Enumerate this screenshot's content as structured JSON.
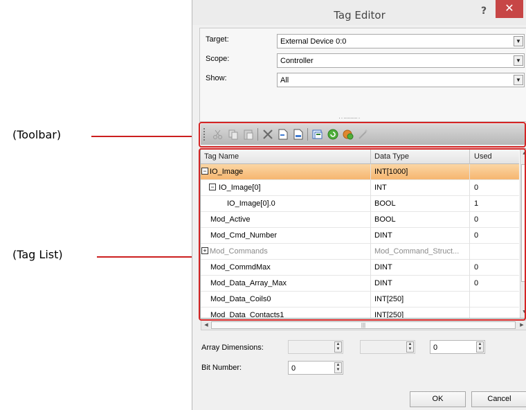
{
  "annotations": {
    "toolbar_label": "(Toolbar)",
    "taglist_label": "(Tag List)",
    "accent": "#d42424"
  },
  "dialog": {
    "title": "Tag Editor",
    "help_glyph": "?",
    "close_glyph": "✕"
  },
  "filters": {
    "target_label": "Target:",
    "target_value": "External Device 0:0",
    "scope_label": "Scope:",
    "scope_value": "Controller",
    "show_label": "Show:",
    "show_value": "All",
    "splitter": "· · ·········· ·"
  },
  "toolbar": {
    "icons": [
      "cut-icon",
      "copy-icon",
      "paste-icon",
      "delete-icon",
      "new-tag-icon",
      "new-structure-icon",
      "import-icon",
      "refresh-icon",
      "monitor-icon",
      "wand-icon"
    ]
  },
  "grid": {
    "columns": [
      "Tag Name",
      "Data Type",
      "Used"
    ],
    "rows": [
      {
        "name": "IO_Image",
        "type": "INT[1000]",
        "used": "",
        "expander": "−",
        "indent": 0,
        "selected": true,
        "grey": false
      },
      {
        "name": "IO_Image[0]",
        "type": "INT",
        "used": "0",
        "expander": "−",
        "indent": 1,
        "selected": false,
        "grey": false
      },
      {
        "name": "IO_Image[0].0",
        "type": "BOOL",
        "used": "1",
        "expander": "",
        "indent": 2,
        "selected": false,
        "grey": false
      },
      {
        "name": "Mod_Active",
        "type": "BOOL",
        "used": "0",
        "expander": "",
        "indent": 1,
        "selected": false,
        "grey": false
      },
      {
        "name": "Mod_Cmd_Number",
        "type": "DINT",
        "used": "0",
        "expander": "",
        "indent": 1,
        "selected": false,
        "grey": false
      },
      {
        "name": "Mod_Commands",
        "type": "Mod_Command_Struct...",
        "used": "",
        "expander": "+",
        "indent": 0,
        "selected": false,
        "grey": true
      },
      {
        "name": "Mod_CommdMax",
        "type": "DINT",
        "used": "0",
        "expander": "",
        "indent": 1,
        "selected": false,
        "grey": false
      },
      {
        "name": "Mod_Data_Array_Max",
        "type": "DINT",
        "used": "0",
        "expander": "",
        "indent": 1,
        "selected": false,
        "grey": false
      },
      {
        "name": "Mod_Data_Coils0",
        "type": "INT[250]",
        "used": "",
        "expander": "",
        "indent": 1,
        "selected": false,
        "grey": false
      },
      {
        "name": "Mod_Data_Contacts1",
        "type": "INT[250]",
        "used": "",
        "expander": "",
        "indent": 1,
        "selected": false,
        "grey": false
      }
    ]
  },
  "bottom": {
    "array_label": "Array Dimensions:",
    "array_values": [
      "",
      "",
      "0"
    ],
    "bit_label": "Bit Number:",
    "bit_value": "0",
    "ok_label": "OK",
    "cancel_label": "Cancel"
  }
}
